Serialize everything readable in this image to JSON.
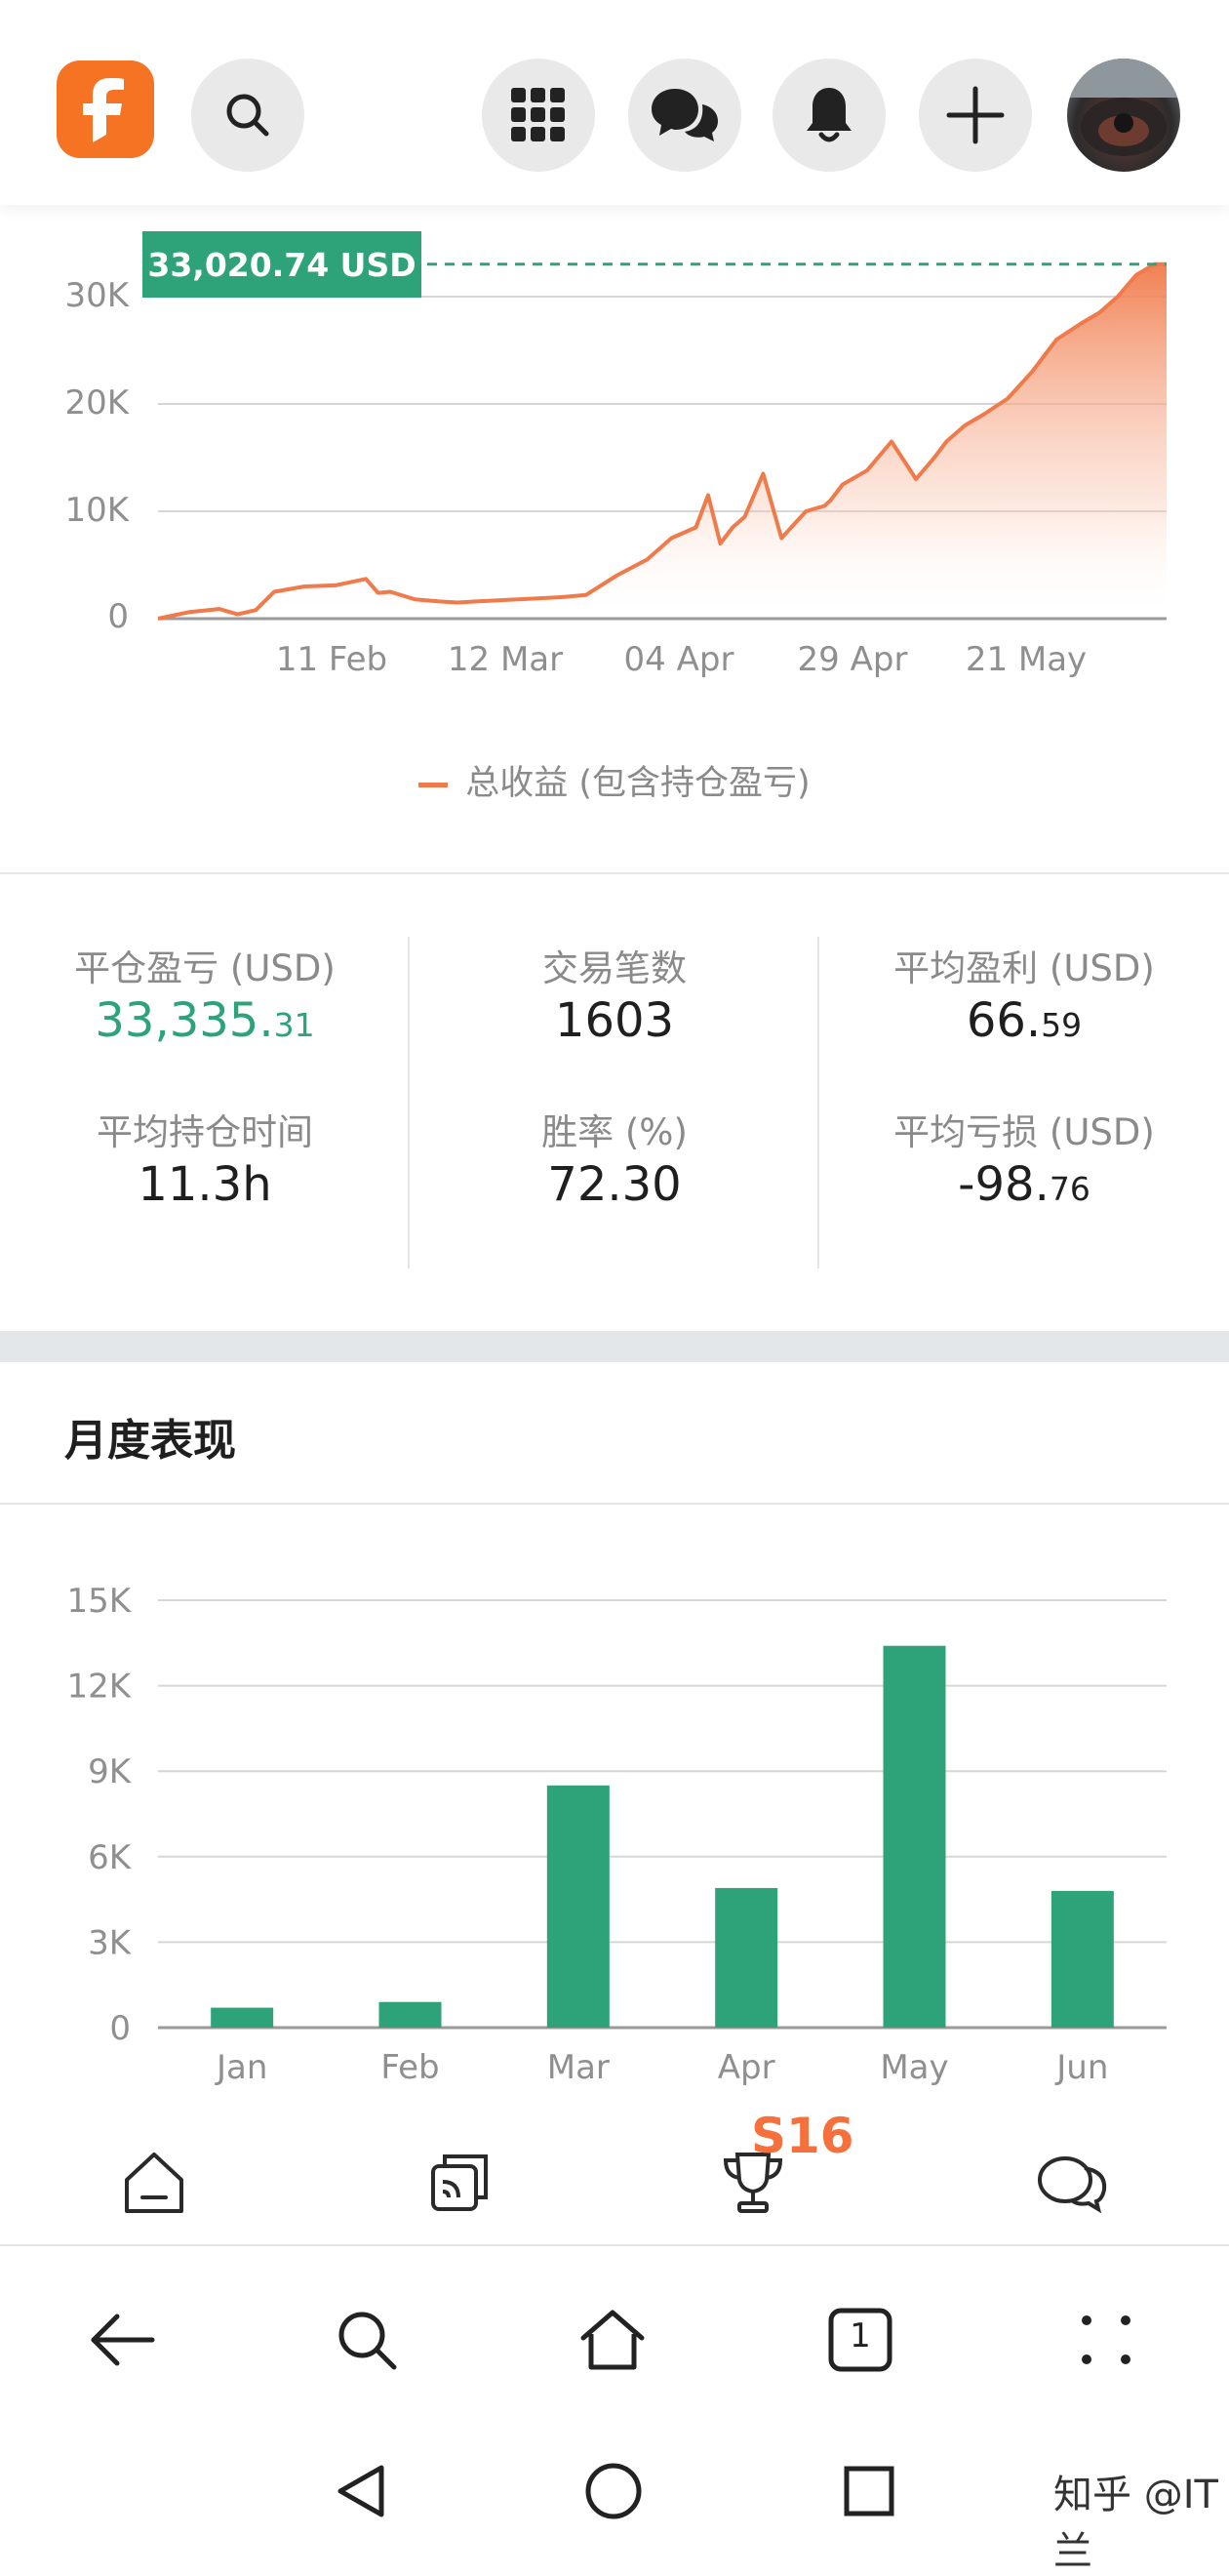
{
  "topbar": {
    "logo_icon": "f-logo",
    "icons": [
      "search-icon",
      "apps-grid-icon",
      "chat-icon",
      "bell-icon",
      "plus-icon"
    ],
    "avatar": "user-avatar"
  },
  "chart_data": [
    {
      "type": "area",
      "title": "",
      "series": [
        {
          "name": "总收益 (包含持仓盈亏)",
          "color": "#f07a4a",
          "x": [
            "2021-01-01",
            "2021-01-06",
            "2021-01-11",
            "2021-01-14",
            "2021-01-17",
            "2021-01-20",
            "2021-01-25",
            "2021-01-30",
            "2021-02-04",
            "2021-02-06",
            "2021-02-08",
            "2021-02-12",
            "2021-02-16",
            "2021-02-19",
            "2021-02-22",
            "2021-03-01",
            "2021-03-08",
            "2021-03-12",
            "2021-03-17",
            "2021-03-22",
            "2021-03-26",
            "2021-03-30",
            "2021-04-01",
            "2021-04-03",
            "2021-04-05",
            "2021-04-07",
            "2021-04-10",
            "2021-04-13",
            "2021-04-17",
            "2021-04-20",
            "2021-04-21",
            "2021-04-23",
            "2021-04-27",
            "2021-05-01",
            "2021-05-05",
            "2021-05-08",
            "2021-05-10",
            "2021-05-13",
            "2021-05-16",
            "2021-05-20",
            "2021-05-24",
            "2021-05-28",
            "2021-06-01",
            "2021-06-04",
            "2021-06-07",
            "2021-06-10",
            "2021-06-13",
            "2021-06-15"
          ],
          "y": [
            0,
            600,
            900,
            400,
            800,
            2500,
            3000,
            3100,
            3700,
            2400,
            2500,
            1800,
            1600,
            1500,
            1600,
            1800,
            2000,
            2200,
            4000,
            5500,
            7500,
            8500,
            11500,
            7000,
            8500,
            9500,
            13500,
            7500,
            10000,
            10500,
            11000,
            12500,
            13800,
            16500,
            13000,
            15000,
            16500,
            18000,
            19000,
            20500,
            23000,
            26000,
            27500,
            28500,
            30000,
            32000,
            33020.74,
            33020.74
          ]
        }
      ],
      "xtick_labels": [
        "11 Feb",
        "12 Mar",
        "04 Apr",
        "29 Apr",
        "21 May"
      ],
      "ytick_labels": [
        "0",
        "10K",
        "20K",
        "30K"
      ],
      "ylim": [
        0,
        33020.74
      ],
      "marker_label": "33,020.74 USD",
      "grid": true,
      "legend": "bottom-center"
    },
    {
      "type": "bar",
      "title": "月度表现",
      "categories": [
        "Jan",
        "Feb",
        "Mar",
        "Apr",
        "May",
        "Jun"
      ],
      "values": [
        700,
        900,
        8500,
        4900,
        13400,
        4800
      ],
      "ytick_labels": [
        "0",
        "3K",
        "6K",
        "9K",
        "12K",
        "15K"
      ],
      "ylim": [
        0,
        15000
      ],
      "color": "#2ea37a",
      "grid": true
    }
  ],
  "legend_label": "总收益 (包含持仓盈亏)",
  "stats": {
    "closed_pnl_label": "平仓盈亏 (USD)",
    "closed_pnl_int": "33,335.",
    "closed_pnl_dec": "31",
    "trades_label": "交易笔数",
    "trades_value": "1603",
    "avg_profit_label": "平均盈利 (USD)",
    "avg_profit_int": "66.",
    "avg_profit_dec": "59",
    "avg_hold_label": "平均持仓时间",
    "avg_hold_value": "11.3h",
    "win_rate_label": "胜率 (%)",
    "win_rate_value": "72.30",
    "avg_loss_label": "平均亏损 (USD)",
    "avg_loss_int": "-98.",
    "avg_loss_dec": "76"
  },
  "monthly_title": "月度表现",
  "app_nav": {
    "badge": "S16",
    "icons": [
      "home-icon",
      "copy-trading-icon",
      "trophy-icon",
      "chat-bubble-icon"
    ]
  },
  "browser_bar": {
    "tab_count": "1",
    "icons": [
      "back-arrow-icon",
      "search-icon",
      "home-icon",
      "tabs-icon",
      "more-icon"
    ]
  },
  "watermark": "知乎 @IT兰",
  "colors": {
    "accent_orange": "#f57322",
    "green": "#2ea37a",
    "line_orange": "#f07a4a"
  }
}
